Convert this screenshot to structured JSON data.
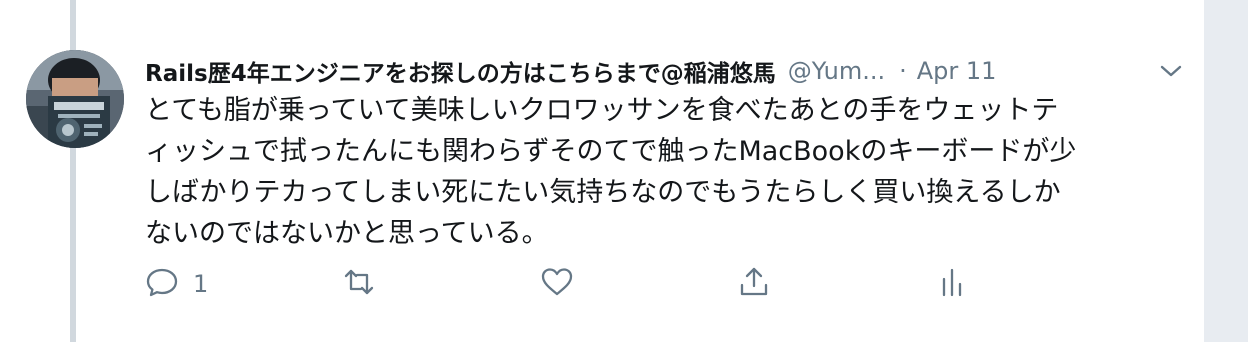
{
  "tweet": {
    "display_name": "Rails歴4年エンジニアをお探しの方はこちらまで@稲浦悠馬",
    "handle": "@Yum...",
    "separator": "·",
    "date": "Apr 11",
    "text_lines": [
      "とても脂が乗っていて美味しいクロワッサンを食べたあとの手をウェットテ",
      "ィッシュで拭ったんにも関わらずそのてで触ったMacBookのキーボードが少",
      "しばかりテカってしまい死にたい気持ちなのでもうたらしく買い換えるしか",
      "ないのではないかと思っている。"
    ]
  },
  "actions": {
    "reply_count": "1",
    "retweet_count": "",
    "like_count": ""
  },
  "icons": {
    "caret": "chevron-down-icon",
    "reply": "reply-icon",
    "retweet": "retweet-icon",
    "like": "heart-icon",
    "share": "share-icon",
    "analytics": "analytics-icon"
  },
  "colors": {
    "text": "#14171a",
    "secondary": "#657786",
    "thread_line": "#d1d8de",
    "gutter": "#e8ecf1"
  }
}
